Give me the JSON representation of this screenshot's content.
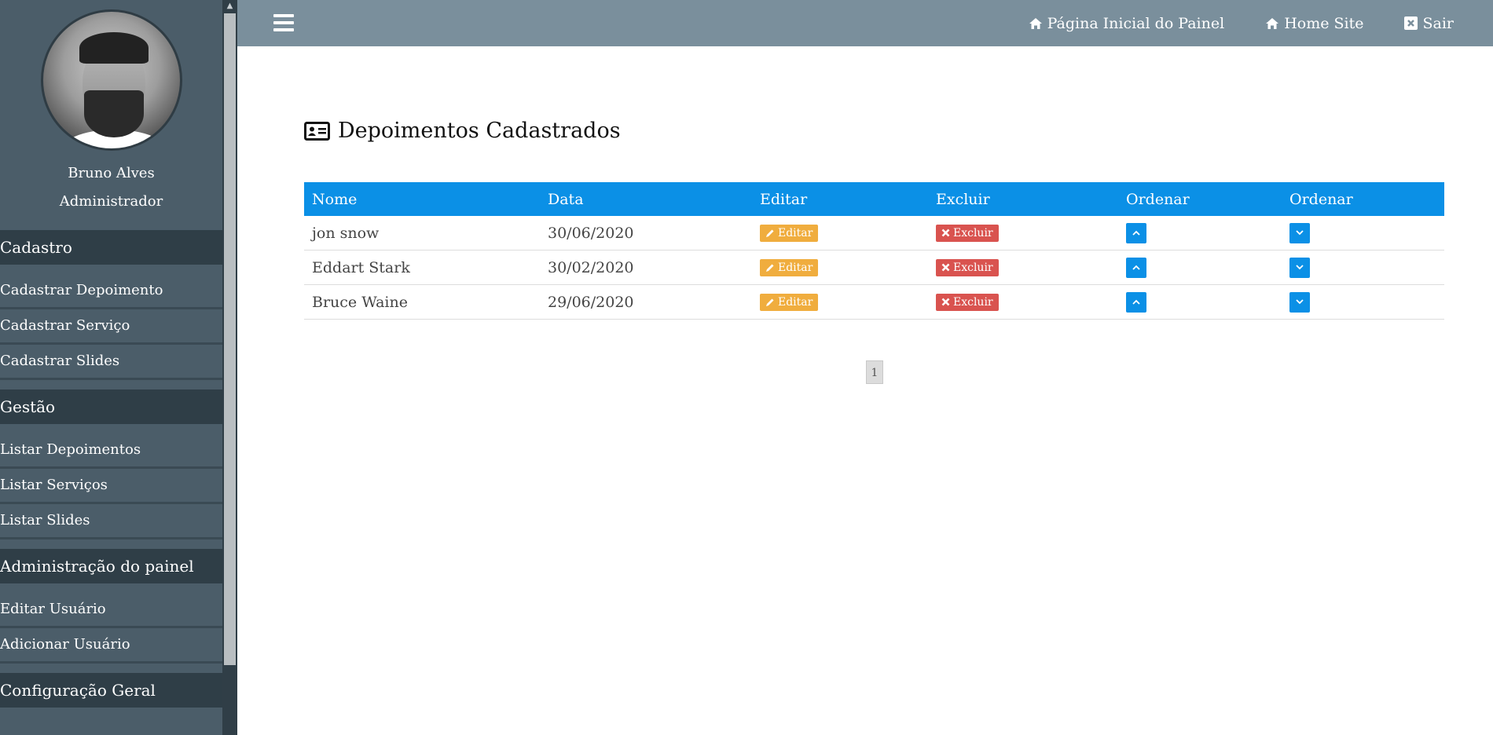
{
  "sidebar": {
    "user_name": "Bruno Alves",
    "user_role": "Administrador",
    "sections": [
      {
        "title": "Cadastro",
        "items": [
          "Cadastrar Depoimento",
          "Cadastrar Serviço",
          "Cadastrar Slides"
        ]
      },
      {
        "title": "Gestão",
        "items": [
          "Listar Depoimentos",
          "Listar Serviços",
          "Listar Slides"
        ]
      },
      {
        "title": "Administração do painel",
        "items": [
          "Editar Usuário",
          "Adicionar Usuário"
        ]
      },
      {
        "title": "Configuração Geral",
        "items": []
      }
    ]
  },
  "topbar": {
    "links": [
      {
        "label": "Página Inicial do Painel",
        "icon": "home-icon"
      },
      {
        "label": "Home Site",
        "icon": "home-icon"
      },
      {
        "label": "Sair",
        "icon": "close-box-icon"
      }
    ]
  },
  "main": {
    "title": "Depoimentos Cadastrados",
    "title_icon": "id-card-icon",
    "table": {
      "headers": [
        "Nome",
        "Data",
        "Editar",
        "Excluir",
        "Ordenar",
        "Ordenar"
      ],
      "edit_label": "Editar",
      "delete_label": "Excluir",
      "rows": [
        {
          "name": "jon snow",
          "date": "30/06/2020"
        },
        {
          "name": "Eddart Stark",
          "date": "30/02/2020"
        },
        {
          "name": "Bruce Waine",
          "date": "29/06/2020"
        }
      ]
    },
    "pagination": {
      "current": "1"
    }
  },
  "colors": {
    "sidebar_bg": "#4b5d69",
    "section_bg": "#2f3e47",
    "topbar_bg": "#7a8f9c",
    "table_header": "#0b90e6",
    "edit_button": "#f0ad3e",
    "delete_button": "#d9534f"
  }
}
